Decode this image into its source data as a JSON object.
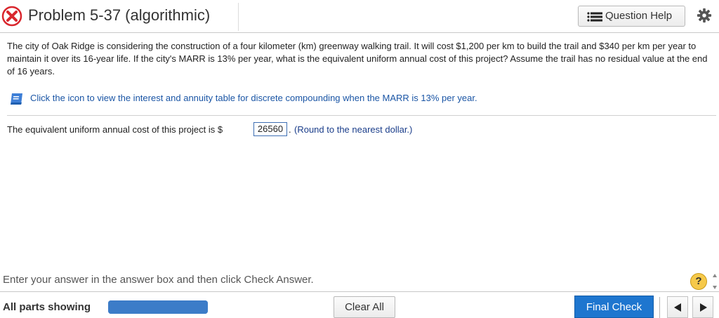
{
  "header": {
    "title": "Problem 5-37 (algorithmic)",
    "status": "incorrect-icon",
    "question_help_label": "Question Help"
  },
  "question": {
    "text": "The city of Oak Ridge is considering the construction of a four kilometer (km) greenway walking trail. It will cost $1,200 per km to build the trail and $340 per km per year to maintain it over its 16-year life. If the city's MARR is 13% per year, what is the equivalent uniform annual cost of this project? Assume the trail has no residual value at the end of 16 years.",
    "table_link": "Click the icon to view the interest and annuity table for discrete compounding when the MARR is 13% per year."
  },
  "answer": {
    "prefix": "The equivalent uniform annual cost of this project is $",
    "value": "26560",
    "suffix": ".",
    "hint": "(Round to the nearest dollar.)"
  },
  "footer": {
    "instruction": "Enter your answer in the answer box and then click Check Answer.",
    "help_label": "?",
    "parts_label": "All parts showing",
    "progress": 1.0,
    "clear_label": "Clear All",
    "final_label": "Final Check"
  },
  "colors": {
    "accent": "#1e76cf",
    "link": "#1a55a5",
    "error": "#d9272e"
  }
}
